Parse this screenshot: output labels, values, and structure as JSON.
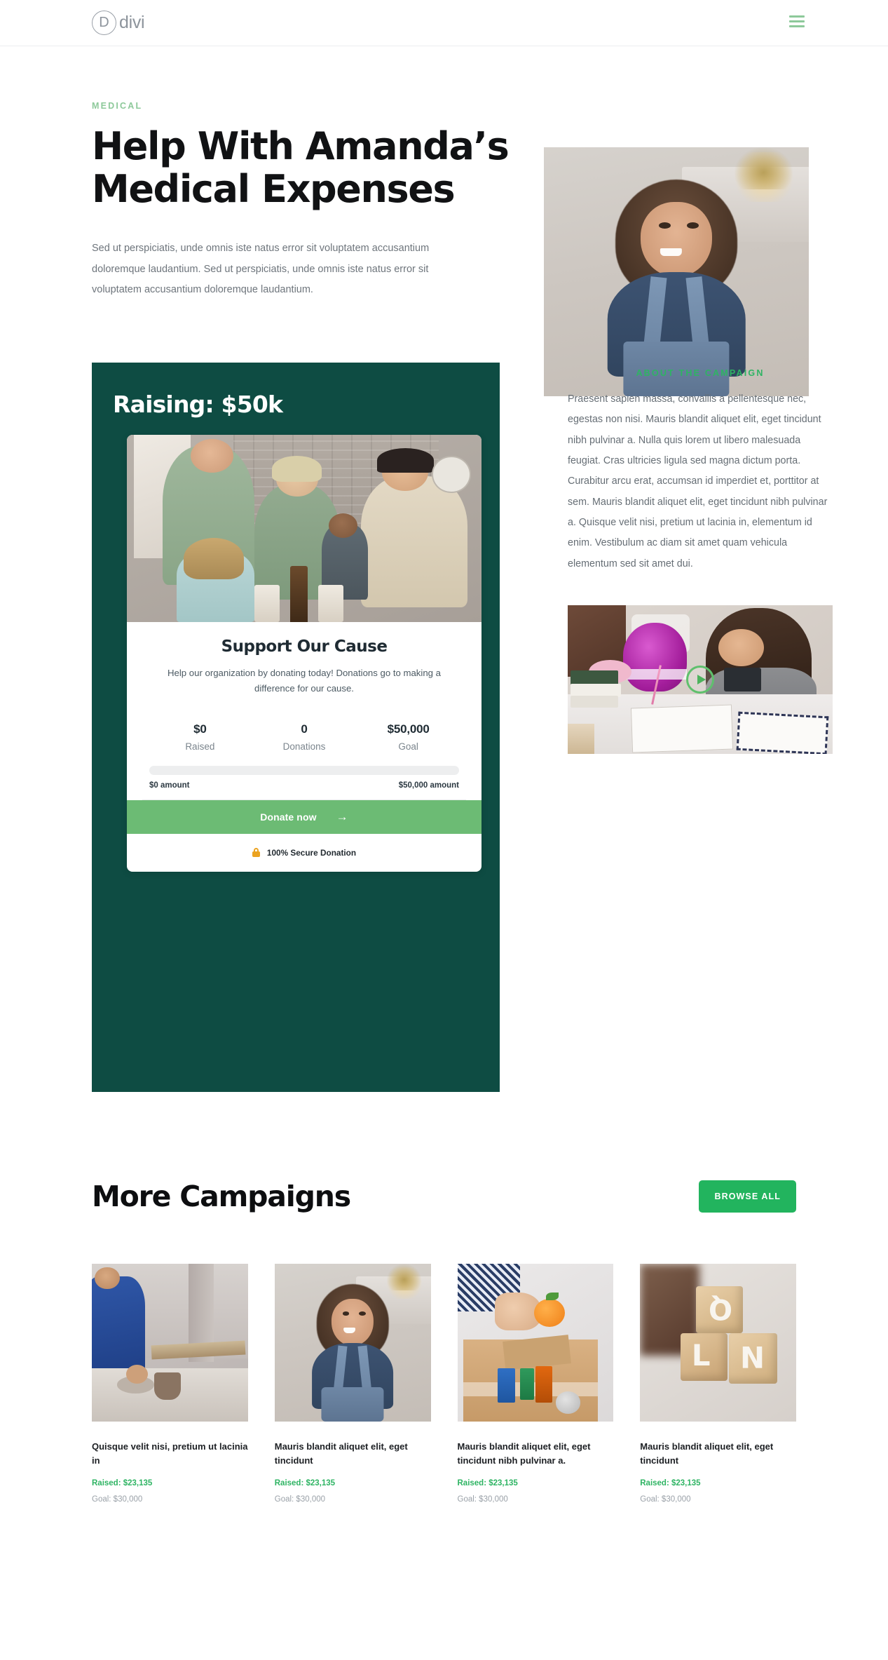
{
  "header": {
    "brand_letter": "D",
    "brand_name": "divi",
    "menu_label": "Menu"
  },
  "hero": {
    "eyebrow": "MEDICAL",
    "title": "Help With Amanda’s Medical Expenses",
    "paragraph": "Sed ut perspiciatis, unde omnis iste natus error sit voluptatem accusantium doloremque laudantium. Sed ut perspiciatis, unde omnis iste natus error sit voluptatem accusantium doloremque laudantium.",
    "image_alt": "smiling-child-portrait"
  },
  "campaign": {
    "raising_title": "Raising: $50k",
    "card": {
      "image_alt": "volunteers-packing-donations",
      "title": "Support Our Cause",
      "subtitle": "Help our organization by donating today! Donations go to making a difference for our cause.",
      "stats": [
        {
          "value": "$0",
          "label": "Raised"
        },
        {
          "value": "0",
          "label": "Donations"
        },
        {
          "value": "$50,000",
          "label": "Goal"
        }
      ],
      "progress_percent": 0,
      "progress_min_label": "$0 amount",
      "progress_max_label": "$50,000 amount",
      "donate_label": "Donate now",
      "donate_arrow": "→",
      "secure_label": "100% Secure Donation"
    }
  },
  "about": {
    "eyebrow": "ABOUT THE CAMPAIGN",
    "paragraph": "Praesent sapien massa, convallis a pellentesque nec, egestas non nisi. Mauris blandit aliquet elit, eget tincidunt nibh pulvinar a. Nulla quis lorem ut libero malesuada feugiat. Cras ultricies ligula sed magna dictum porta. Curabitur arcu erat, accumsan id imperdiet et, porttitor at sem. Mauris blandit aliquet elit, eget tincidunt nibh pulvinar a. Quisque velit nisi, pretium ut lacinia in, elementum id enim. Vestibulum ac diam sit amet quam vehicula elementum sed sit amet dui.",
    "video_alt": "girl-studying-at-desk"
  },
  "more": {
    "title": "More Campaigns",
    "browse_label": "BROWSE ALL",
    "cards": [
      {
        "image_alt": "potter-at-wheel",
        "name": "Quisque velit nisi, pretium ut lacinia in",
        "raised": "Raised: $23,135",
        "goal": "Goal: $30,000"
      },
      {
        "image_alt": "smiling-child-portrait",
        "name": "Mauris blandit aliquet elit, eget tincidunt",
        "raised": "Raised: $23,135",
        "goal": "Goal: $30,000"
      },
      {
        "image_alt": "hand-placing-orange-in-food-box",
        "name": "Mauris blandit aliquet elit, eget tincidunt nibh pulvinar a.",
        "raised": "Raised: $23,135",
        "goal": "Goal: $30,000"
      },
      {
        "image_alt": "wooden-alphabet-blocks",
        "name": "Mauris blandit aliquet elit, eget tincidunt",
        "raised": "Raised: $23,135",
        "goal": "Goal: $30,000"
      }
    ]
  },
  "colors": {
    "accent_green": "#2eb463",
    "light_green": "#8dc99a",
    "button_green": "#6cbb74",
    "browse_green": "#22b45e",
    "panel_dark_green": "#0e4c43",
    "lock_orange": "#eba321"
  }
}
